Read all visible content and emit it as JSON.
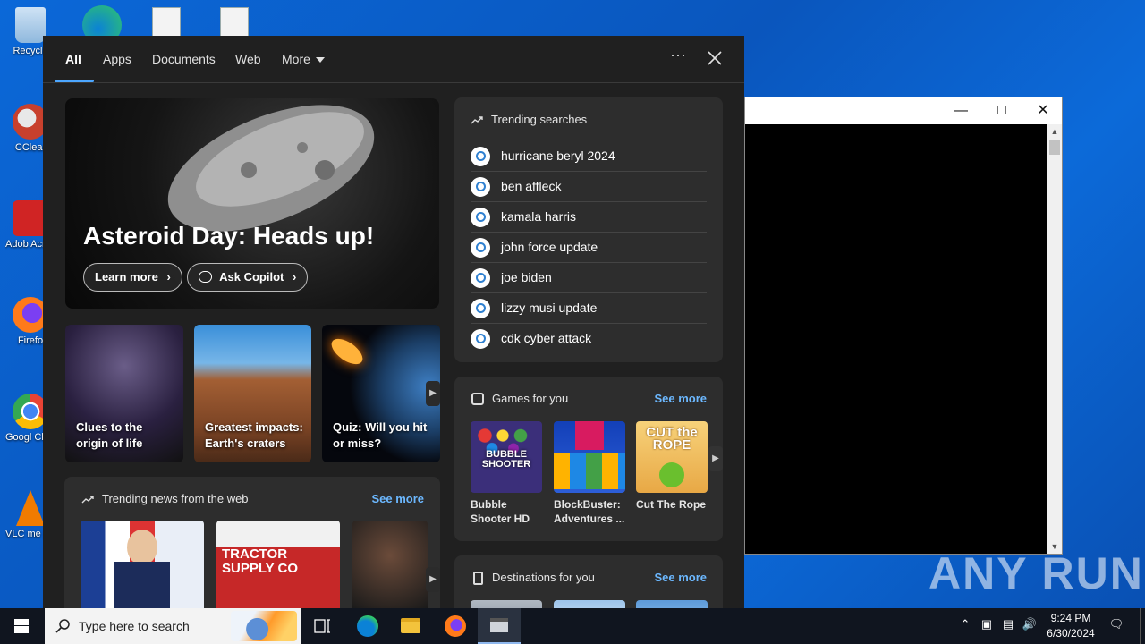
{
  "desktop": {
    "icons": [
      {
        "label": "Recycle",
        "color": "#9fc4e6"
      },
      {
        "label": "CClear",
        "color": "#c8402d"
      },
      {
        "label": "Adob Acrob",
        "color": "#d02424"
      },
      {
        "label": "Firefo",
        "color": "#ff7a1a"
      },
      {
        "label": "Googl Chrom",
        "color": "#34a853"
      },
      {
        "label": "VLC me playe",
        "color": "#f07b00"
      }
    ],
    "watermark": "ANY RUN"
  },
  "search_panel": {
    "tabs": [
      "All",
      "Apps",
      "Documents",
      "Web",
      "More"
    ],
    "active_tab": "All",
    "more_icon": "ellipsis-icon",
    "hero": {
      "title": "Asteroid Day: Heads up!",
      "learn_more": "Learn more",
      "ask_copilot": "Ask Copilot"
    },
    "mini_cards": [
      {
        "caption": "Clues to the origin of life"
      },
      {
        "caption": "Greatest impacts: Earth's craters"
      },
      {
        "caption": "Quiz: Will you hit or miss?"
      }
    ],
    "trending_searches": {
      "title": "Trending searches",
      "items": [
        "hurricane beryl 2024",
        "ben affleck",
        "kamala harris",
        "john force update",
        "joe biden",
        "lizzy musi update",
        "cdk cyber attack"
      ]
    },
    "games": {
      "title": "Games for you",
      "see_more": "See more",
      "items": [
        {
          "name": "Bubble Shooter HD",
          "logo": "BUBBLE SHOOTER"
        },
        {
          "name": "BlockBuster: Adventures ...",
          "logo": ""
        },
        {
          "name": "Cut The Rope",
          "logo": "CUT the ROPE"
        }
      ]
    },
    "news": {
      "title": "Trending news from the web",
      "see_more": "See more",
      "sign_text": "TRACTOR SUPPLY CO"
    },
    "destinations": {
      "title": "Destinations for you",
      "see_more": "See more"
    }
  },
  "taskbar": {
    "search_placeholder": "Type here to search",
    "time": "9:24 PM",
    "date": "6/30/2024"
  },
  "colors": {
    "accent": "#4ca6ff",
    "link": "#6cb8ff",
    "panel_bg": "#202020",
    "card_bg": "#2d2d2d"
  }
}
